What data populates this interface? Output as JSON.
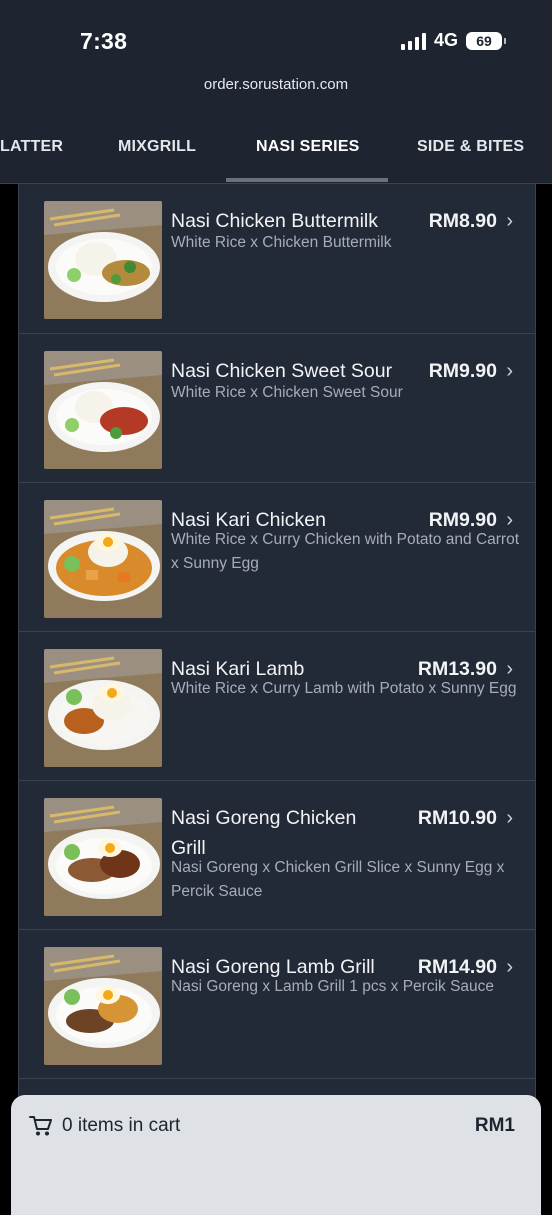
{
  "status": {
    "time": "7:38",
    "network": "4G",
    "battery": "69"
  },
  "browser": {
    "url": "order.sorustation.com"
  },
  "tabs": [
    "LATTER",
    "MIXGRILL",
    "NASI SERIES",
    "SIDE & BITES"
  ],
  "active_tab": "NASI SERIES",
  "menu": [
    {
      "name": "Nasi Chicken Buttermilk",
      "price": "RM8.90",
      "description": "White Rice x Chicken Buttermilk",
      "image": "rice-chicken-buttermilk-photo"
    },
    {
      "name": "Nasi Chicken Sweet Sour",
      "price": "RM9.90",
      "description": "White Rice x Chicken Sweet Sour",
      "image": "rice-chicken-sweet-sour-photo"
    },
    {
      "name": "Nasi Kari Chicken",
      "price": "RM9.90",
      "description": "White Rice x Curry Chicken with Potato and Carrot x Sunny Egg",
      "image": "rice-curry-chicken-photo"
    },
    {
      "name": "Nasi Kari Lamb",
      "price": "RM13.90",
      "description": "White Rice x Curry Lamb with Potato x Sunny Egg",
      "image": "rice-curry-lamb-photo"
    },
    {
      "name": "Nasi Goreng Chicken Grill",
      "price": "RM10.90",
      "description": "Nasi Goreng x Chicken Grill Slice x Sunny Egg x Percik Sauce",
      "image": "fried-rice-chicken-grill-photo"
    },
    {
      "name": "Nasi Goreng Lamb Grill",
      "price": "RM14.90",
      "description": "Nasi Goreng x Lamb Grill 1 pcs x Percik Sauce",
      "image": "fried-rice-lamb-grill-photo"
    }
  ],
  "cart": {
    "label": "0 items in cart",
    "total": "RM1"
  },
  "colors": {
    "header_bg": "#1e2430",
    "list_bg": "#222937",
    "cart_bg": "#dee1e6"
  }
}
